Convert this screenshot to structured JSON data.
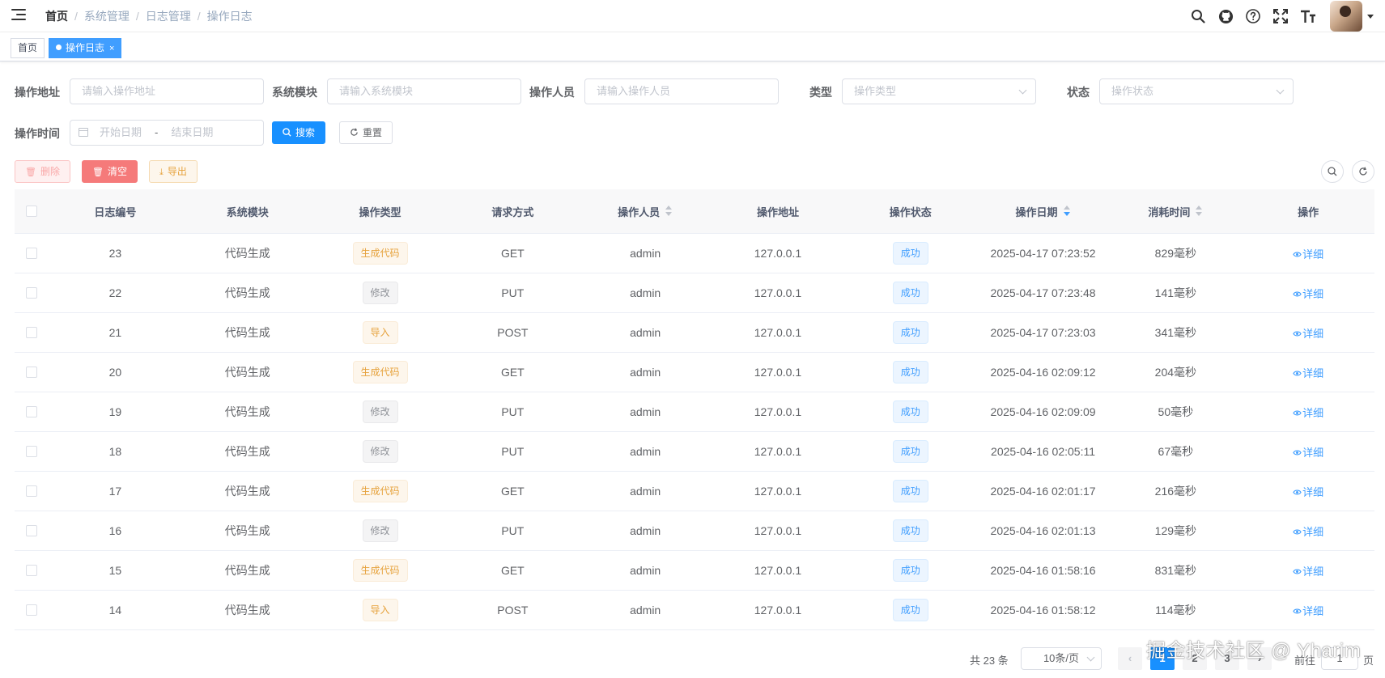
{
  "navbar": {
    "breadcrumb": [
      "首页",
      "系统管理",
      "日志管理",
      "操作日志"
    ]
  },
  "tags": [
    {
      "label": "首页",
      "active": false
    },
    {
      "label": "操作日志",
      "active": true
    }
  ],
  "search": {
    "oper_ip_label": "操作地址",
    "oper_ip_placeholder": "请输入操作地址",
    "module_label": "系统模块",
    "module_placeholder": "请输入系统模块",
    "oper_name_label": "操作人员",
    "oper_name_placeholder": "请输入操作人员",
    "type_label": "类型",
    "type_placeholder": "操作类型",
    "status_label": "状态",
    "status_placeholder": "操作状态",
    "time_label": "操作时间",
    "start_placeholder": "开始日期",
    "date_sep": "-",
    "end_placeholder": "结束日期",
    "search_button": "搜索",
    "reset_button": "重置"
  },
  "toolbar": {
    "delete": "删除",
    "clean": "清空",
    "export": "导出"
  },
  "table": {
    "headers": [
      "日志编号",
      "系统模块",
      "操作类型",
      "请求方式",
      "操作人员",
      "操作地址",
      "操作状态",
      "操作日期",
      "消耗时间",
      "操作"
    ],
    "rows": [
      {
        "id": "23",
        "module": "代码生成",
        "type": "生成代码",
        "type_style": "warning",
        "method": "GET",
        "user": "admin",
        "ip": "127.0.0.1",
        "status": "成功",
        "time": "2025-04-17 07:23:52",
        "cost": "829毫秒",
        "action": "详细"
      },
      {
        "id": "22",
        "module": "代码生成",
        "type": "修改",
        "type_style": "info",
        "method": "PUT",
        "user": "admin",
        "ip": "127.0.0.1",
        "status": "成功",
        "time": "2025-04-17 07:23:48",
        "cost": "141毫秒",
        "action": "详细"
      },
      {
        "id": "21",
        "module": "代码生成",
        "type": "导入",
        "type_style": "warning",
        "method": "POST",
        "user": "admin",
        "ip": "127.0.0.1",
        "status": "成功",
        "time": "2025-04-17 07:23:03",
        "cost": "341毫秒",
        "action": "详细"
      },
      {
        "id": "20",
        "module": "代码生成",
        "type": "生成代码",
        "type_style": "warning",
        "method": "GET",
        "user": "admin",
        "ip": "127.0.0.1",
        "status": "成功",
        "time": "2025-04-16 02:09:12",
        "cost": "204毫秒",
        "action": "详细"
      },
      {
        "id": "19",
        "module": "代码生成",
        "type": "修改",
        "type_style": "info",
        "method": "PUT",
        "user": "admin",
        "ip": "127.0.0.1",
        "status": "成功",
        "time": "2025-04-16 02:09:09",
        "cost": "50毫秒",
        "action": "详细"
      },
      {
        "id": "18",
        "module": "代码生成",
        "type": "修改",
        "type_style": "info",
        "method": "PUT",
        "user": "admin",
        "ip": "127.0.0.1",
        "status": "成功",
        "time": "2025-04-16 02:05:11",
        "cost": "67毫秒",
        "action": "详细"
      },
      {
        "id": "17",
        "module": "代码生成",
        "type": "生成代码",
        "type_style": "warning",
        "method": "GET",
        "user": "admin",
        "ip": "127.0.0.1",
        "status": "成功",
        "time": "2025-04-16 02:01:17",
        "cost": "216毫秒",
        "action": "详细"
      },
      {
        "id": "16",
        "module": "代码生成",
        "type": "修改",
        "type_style": "info",
        "method": "PUT",
        "user": "admin",
        "ip": "127.0.0.1",
        "status": "成功",
        "time": "2025-04-16 02:01:13",
        "cost": "129毫秒",
        "action": "详细"
      },
      {
        "id": "15",
        "module": "代码生成",
        "type": "生成代码",
        "type_style": "warning",
        "method": "GET",
        "user": "admin",
        "ip": "127.0.0.1",
        "status": "成功",
        "time": "2025-04-16 01:58:16",
        "cost": "831毫秒",
        "action": "详细"
      },
      {
        "id": "14",
        "module": "代码生成",
        "type": "导入",
        "type_style": "warning",
        "method": "POST",
        "user": "admin",
        "ip": "127.0.0.1",
        "status": "成功",
        "time": "2025-04-16 01:58:12",
        "cost": "114毫秒",
        "action": "详细"
      }
    ]
  },
  "pagination": {
    "total": "共 23 条",
    "page_size": "10条/页",
    "pages": [
      "1",
      "2",
      "3"
    ],
    "current": "1",
    "goto_prefix": "前往",
    "goto_value": "1",
    "goto_suffix": "页"
  },
  "watermark": "掘金技术社区 @ Yharim",
  "colors": {
    "primary": "#1890ff",
    "link": "#409eff",
    "warning": "#e6a23c",
    "danger": "#f56c6c"
  }
}
